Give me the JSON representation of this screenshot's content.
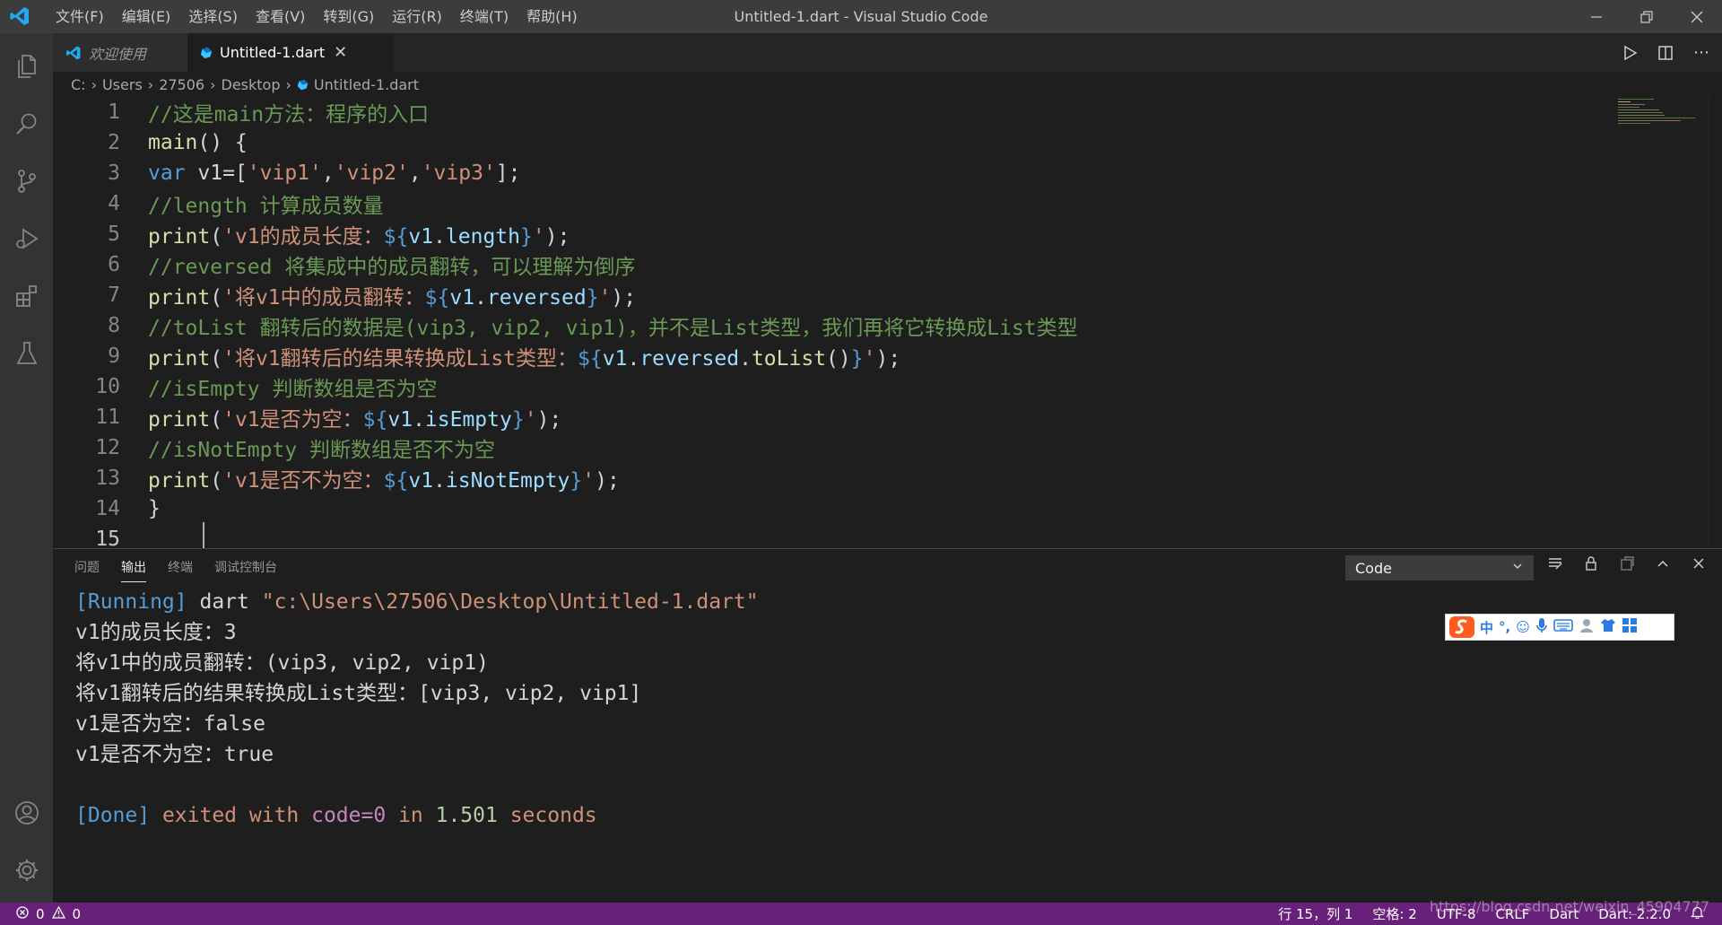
{
  "titlebar": {
    "title": "Untitled-1.dart - Visual Studio Code",
    "menu": [
      "文件(F)",
      "编辑(E)",
      "选择(S)",
      "查看(V)",
      "转到(G)",
      "运行(R)",
      "终端(T)",
      "帮助(H)"
    ]
  },
  "tabs": {
    "welcome": "欢迎使用",
    "active": "Untitled-1.dart"
  },
  "breadcrumb": [
    "C:",
    "Users",
    "27506",
    "Desktop",
    "Untitled-1.dart"
  ],
  "editor": {
    "line_numbers": [
      "1",
      "2",
      "3",
      "4",
      "5",
      "6",
      "7",
      "8",
      "9",
      "10",
      "11",
      "12",
      "13",
      "14",
      "15"
    ],
    "lines": {
      "l1": "//这是main方法：程序的入口",
      "l2a": "main",
      "l2b": "() {",
      "l3a": "var",
      "l3b": " v1",
      "l3c": "=[",
      "l3d": "'vip1'",
      "l3e": ",",
      "l3f": "'vip2'",
      "l3g": ",",
      "l3h": "'vip3'",
      "l3i": "];",
      "l4": "//length 计算成员数量",
      "l5a": "print",
      "l5b": "(",
      "l5c": "'v1的成员长度：",
      "l5d": "${",
      "l5e": "v1",
      "l5f": ".",
      "l5g": "length",
      "l5h": "}",
      "l5i": "'",
      "l5j": ");",
      "l6": "//reversed 将集成中的成员翻转，可以理解为倒序",
      "l7a": "print",
      "l7b": "(",
      "l7c": "'将v1中的成员翻转：",
      "l7d": "${",
      "l7e": "v1",
      "l7f": ".",
      "l7g": "reversed",
      "l7h": "}",
      "l7i": "'",
      "l7j": ");",
      "l8": "//toList 翻转后的数据是(vip3, vip2, vip1)，并不是List类型，我们再将它转换成List类型",
      "l9a": "print",
      "l9b": "(",
      "l9c": "'将v1翻转后的结果转换成List类型：",
      "l9d": "${",
      "l9e": "v1",
      "l9f": ".",
      "l9g": "reversed",
      "l9h": ".",
      "l9i": "toList",
      "l9j": "()",
      "l9k": "}",
      "l9l": "'",
      "l9m": ");",
      "l10": "//isEmpty 判断数组是否为空",
      "l11a": "print",
      "l11b": "(",
      "l11c": "'v1是否为空：",
      "l11d": "${",
      "l11e": "v1",
      "l11f": ".",
      "l11g": "isEmpty",
      "l11h": "}",
      "l11i": "'",
      "l11j": ");",
      "l12": "//isNotEmpty 判断数组是否不为空",
      "l13a": "print",
      "l13b": "(",
      "l13c": "'v1是否不为空：",
      "l13d": "${",
      "l13e": "v1",
      "l13f": ".",
      "l13g": "isNotEmpty",
      "l13h": "}",
      "l13i": "'",
      "l13j": ");",
      "l14": "}"
    }
  },
  "panel": {
    "tabs": [
      "问题",
      "输出",
      "终端",
      "调试控制台"
    ],
    "active_tab": "输出",
    "select_value": "Code",
    "output": {
      "run_tag": "[Running]",
      "run_cmd": " dart ",
      "run_path": "\"c:\\Users\\27506\\Desktop\\Untitled-1.dart\"",
      "line2": "v1的成员长度：3",
      "line3": "将v1中的成员翻转：(vip3, vip2, vip1)",
      "line4": "将v1翻转后的结果转换成List类型：[vip3, vip2, vip1]",
      "line5": "v1是否为空：false",
      "line6": "v1是否不为空：true",
      "done_tag": "[Done]",
      "done_a": " exited ",
      "done_b": "with",
      "done_c": " code=",
      "done_d": "0",
      "done_e": " in ",
      "done_f": "1.501",
      "done_g": " seconds"
    }
  },
  "ime": {
    "lang": "中",
    "punct": "°,"
  },
  "statusbar": {
    "errors": "0",
    "warnings": "0",
    "position": "行 15，列 1",
    "spaces": "空格: 2",
    "encoding": "UTF-8",
    "eol": "CRLF",
    "language": "Dart",
    "sdk": "Dart: 2.2.0"
  },
  "watermark": "https://blog.csdn.net/weixin_45904777",
  "colors": {
    "accent": "#007acc",
    "statusbar": "#68217a",
    "comment": "#6a9955",
    "string": "#ce9178",
    "function": "#dcdcaa",
    "keyword": "#569cd6"
  }
}
